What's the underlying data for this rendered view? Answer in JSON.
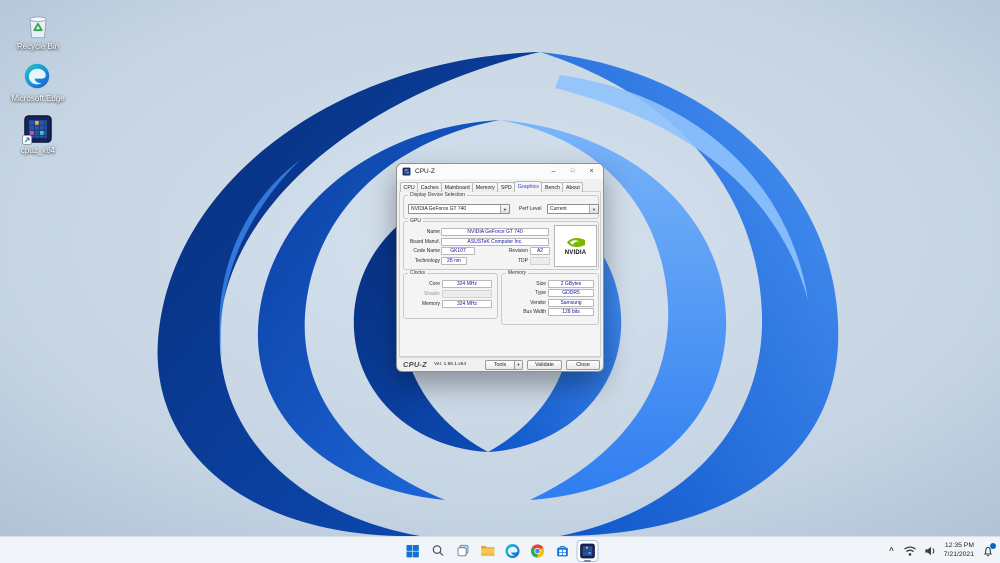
{
  "colors": {
    "nvidia_green": "#76b900",
    "field_text": "#1414a0",
    "active_tab_text": "#2741d6",
    "taskbar_accent": "#1172d3"
  },
  "desktop": {
    "icons": [
      {
        "label": "Recycle Bin"
      },
      {
        "label": "Microsoft Edge"
      },
      {
        "label": "cpuz_x64"
      }
    ]
  },
  "cpuz": {
    "title": "CPU-Z",
    "controls": {
      "minimize": "–",
      "maximize": "□",
      "close": "×"
    },
    "tabs": [
      "CPU",
      "Caches",
      "Mainboard",
      "Memory",
      "SPD",
      "Graphics",
      "Bench",
      "About"
    ],
    "active_tab": "Graphics",
    "device_group": {
      "label": "Display Device Selection",
      "device": "NVIDIA GeForce GT 740",
      "perf_label": "Perf Level",
      "perf_value": "Current"
    },
    "gpu": {
      "label": "GPU",
      "name_label": "Name",
      "name": "NVIDIA GeForce GT 740",
      "board_label": "Board Manuf.",
      "board": "ASUSTeK Computer Inc.",
      "code_label": "Code Name",
      "code": "GK107",
      "revision_label": "Revision",
      "revision": "A2",
      "tech_label": "Technology",
      "tech": "28 nm",
      "tdp_label": "TDP",
      "tdp": "",
      "logo_text": "NVIDIA"
    },
    "clocks": {
      "label": "Clocks",
      "core_label": "Core",
      "core": "324 MHz",
      "shader_label": "Shader",
      "shader": "",
      "memory_label": "Memory",
      "memory": "324 MHz"
    },
    "memory": {
      "label": "Memory",
      "size_label": "Size",
      "size": "2 GBytes",
      "type_label": "Type",
      "type": "GDDR5",
      "vendor_label": "Vendor",
      "vendor": "Samsung",
      "bus_label": "Bus Width",
      "bus": "128 bits"
    },
    "footer": {
      "logo": "CPU-Z",
      "version": "Ver. 1.96.1.x64",
      "tools": "Tools",
      "validate": "Validate",
      "close": "Close"
    }
  },
  "glyphs": {
    "dropdown": "▼",
    "tray_chevron": "^"
  },
  "taskbar": {
    "tray": {
      "time": "12:35 PM",
      "date": "7/21/2021"
    }
  }
}
